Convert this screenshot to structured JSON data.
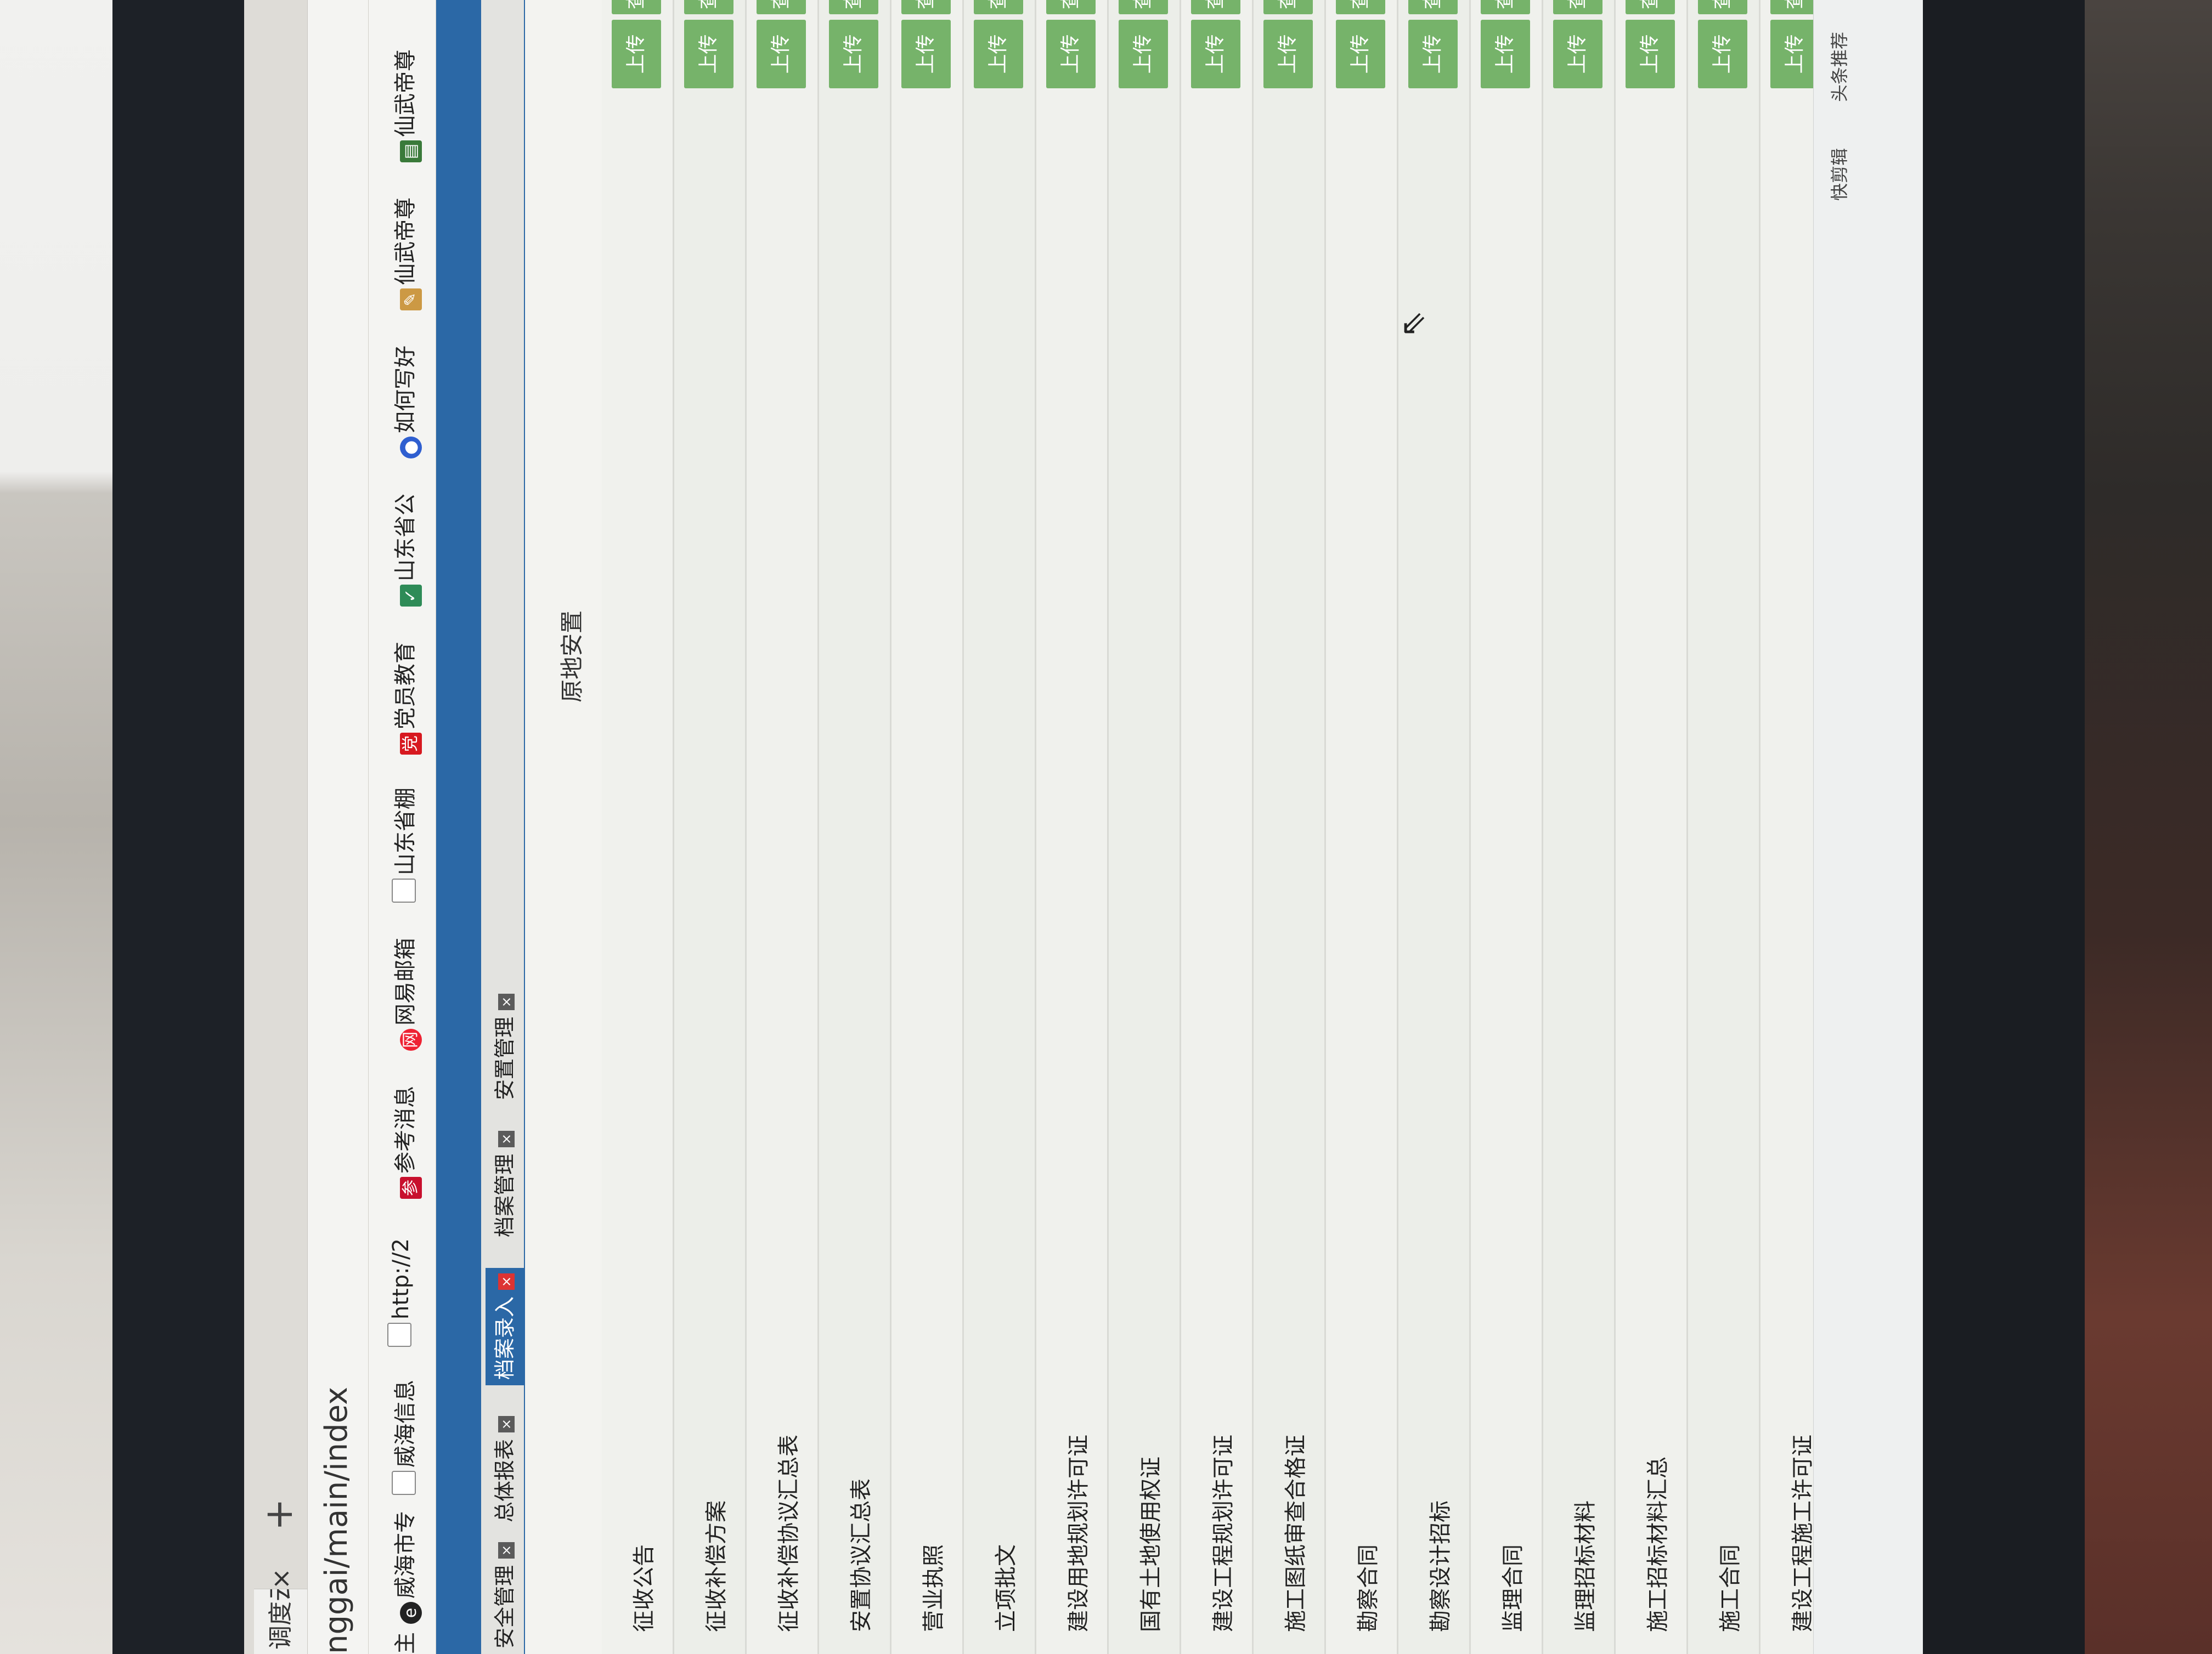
{
  "browser": {
    "tab_title": "调度云平",
    "tab_close": "×",
    "new_tab": "+",
    "url_fragment": "nggai/main/index"
  },
  "bookmarks": [
    {
      "label": "主",
      "icon": "home-icon"
    },
    {
      "label": "威海市专",
      "icon": "e-logo-icon"
    },
    {
      "label": "威海信息",
      "icon": "page-icon"
    },
    {
      "label": "http://2",
      "icon": "page-icon"
    },
    {
      "label": "参考消息",
      "icon": "cankao-icon"
    },
    {
      "label": "网易邮箱",
      "icon": "netease-icon"
    },
    {
      "label": "山东省棚",
      "icon": "page-icon"
    },
    {
      "label": "党员教育",
      "icon": "party-icon"
    },
    {
      "label": "山东省公",
      "icon": "check-icon"
    },
    {
      "label": "如何写好",
      "icon": "baidu-paw-icon"
    },
    {
      "label": "仙武帝尊",
      "icon": "pen-icon"
    },
    {
      "label": "仙武帝尊",
      "icon": "book-icon"
    }
  ],
  "page_tabs": [
    {
      "label": "安全管理",
      "active": false
    },
    {
      "label": "总体报表",
      "active": false
    },
    {
      "label": "档案录入",
      "active": true
    },
    {
      "label": "档案管理",
      "active": false
    },
    {
      "label": "安置管理",
      "active": false
    }
  ],
  "section_title": "原地安置",
  "rows": [
    {
      "label": "征收公告",
      "upload": "上传",
      "view": "查看"
    },
    {
      "label": "征收补偿方案",
      "upload": "上传",
      "view": "查看"
    },
    {
      "label": "征收补偿协议汇总表",
      "upload": "上传",
      "view": "查看"
    },
    {
      "label": "安置协议汇总表",
      "upload": "上传",
      "view": "查看"
    },
    {
      "label": "营业执照",
      "upload": "上传",
      "view": "查看"
    },
    {
      "label": "立项批文",
      "upload": "上传",
      "view": "查看"
    },
    {
      "label": "建设用地规划许可证",
      "upload": "上传",
      "view": "查看"
    },
    {
      "label": "国有土地使用权证",
      "upload": "上传",
      "view": "查看"
    },
    {
      "label": "建设工程规划许可证",
      "upload": "上传",
      "view": "查看"
    },
    {
      "label": "施工图纸审查合格证",
      "upload": "上传",
      "view": "查看"
    },
    {
      "label": "勘察合同",
      "upload": "上传",
      "view": "查看"
    },
    {
      "label": "勘察设计招标",
      "upload": "上传",
      "view": "查看"
    },
    {
      "label": "监理合同",
      "upload": "上传",
      "view": "查看"
    },
    {
      "label": "监理招标材料",
      "upload": "上传",
      "view": "查看"
    },
    {
      "label": "施工招标材料汇总",
      "upload": "上传",
      "view": "查看"
    },
    {
      "label": "施工合同",
      "upload": "上传",
      "view": "查看"
    },
    {
      "label": "建设工程施工许可证",
      "upload": "上传",
      "view": "查看"
    }
  ],
  "statusbar": {
    "item1": "快剪辑",
    "item2": "头条推荐"
  },
  "colors": {
    "header_blue": "#2b68a6",
    "button_green": "#76b36a",
    "active_tab_close": "#dd3333"
  }
}
